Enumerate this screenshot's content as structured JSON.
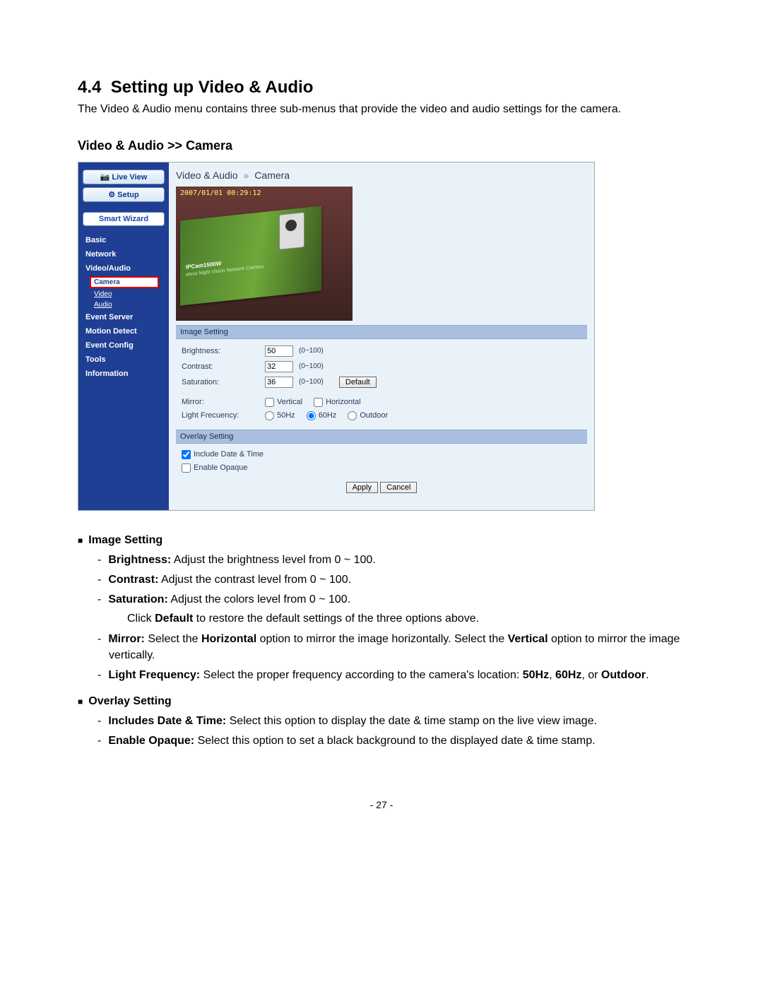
{
  "section": {
    "number": "4.4",
    "title": "Setting up Video & Audio",
    "intro": "The Video & Audio menu contains three sub-menus that provide the video and audio settings for the camera.",
    "sub_title": "Video & Audio >> Camera"
  },
  "sidebar": {
    "live_view": "Live View",
    "setup": "Setup",
    "smart_wizard": "Smart Wizard",
    "items": [
      {
        "label": "Basic"
      },
      {
        "label": "Network"
      },
      {
        "label": "Video/Audio",
        "children": [
          {
            "label": "Camera",
            "selected": true
          },
          {
            "label": "Video"
          },
          {
            "label": "Audio"
          }
        ]
      },
      {
        "label": "Event Server"
      },
      {
        "label": "Motion Detect"
      },
      {
        "label": "Event Config"
      },
      {
        "label": "Tools"
      },
      {
        "label": "Information"
      }
    ]
  },
  "breadcrumb": {
    "a": "Video & Audio",
    "sep": "»",
    "b": "Camera"
  },
  "preview": {
    "timestamp": "2007/01/01 00:29:12",
    "product_line1": "IPCam1500W",
    "product_line2": "eless Night Vision Network Camera"
  },
  "image_setting": {
    "header": "Image Setting",
    "brightness": {
      "label": "Brightness:",
      "value": "50",
      "hint": "(0~100)"
    },
    "contrast": {
      "label": "Contrast:",
      "value": "32",
      "hint": "(0~100)"
    },
    "saturation": {
      "label": "Saturation:",
      "value": "36",
      "hint": "(0~100)"
    },
    "default_btn": "Default",
    "mirror": {
      "label": "Mirror:",
      "vertical": "Vertical",
      "horizontal": "Horizontal",
      "vertical_checked": false,
      "horizontal_checked": false
    },
    "light_freq": {
      "label": "Light Frecuency:",
      "opt50": "50Hz",
      "opt60": "60Hz",
      "optOutdoor": "Outdoor",
      "selected": "60Hz"
    }
  },
  "overlay_setting": {
    "header": "Overlay Setting",
    "include_dt": {
      "label": "Include Date & Time",
      "checked": true
    },
    "enable_opaque": {
      "label": "Enable Opaque",
      "checked": false
    }
  },
  "buttons": {
    "apply": "Apply",
    "cancel": "Cancel"
  },
  "desc": {
    "image_setting_head": "Image Setting",
    "brightness_b": "Brightness:",
    "brightness_t": " Adjust the brightness level from 0 ~ 100.",
    "contrast_b": "Contrast:",
    "contrast_t": " Adjust the contrast level from 0 ~ 100.",
    "saturation_b": "Saturation:",
    "saturation_t": " Adjust the colors level from 0 ~ 100.",
    "default_pre": "Click ",
    "default_b": "Default",
    "default_post": " to restore the default settings of the three options above.",
    "mirror_b": "Mirror:",
    "mirror_t1": " Select the ",
    "mirror_hb": "Horizontal",
    "mirror_t2": " option to mirror the image horizontally. Select the ",
    "mirror_vb": "Vertical",
    "mirror_t3": " option to mirror the image vertically.",
    "light_b": "Light Frequency:",
    "light_t1": " Select the proper frequency according to the camera's location: ",
    "light_50b": "50Hz",
    "light_c1": ", ",
    "light_60b": "60Hz",
    "light_c2": ", or ",
    "light_ob": "Outdoor",
    "light_dot": ".",
    "overlay_setting_head": "Overlay Setting",
    "inc_b": "Includes Date & Time:",
    "inc_t": " Select this option to display the date & time stamp on the live view image.",
    "opq_b": "Enable Opaque:",
    "opq_t": " Select this option to set a black background to the displayed date & time stamp."
  },
  "footer": {
    "page": "- 27 -"
  }
}
